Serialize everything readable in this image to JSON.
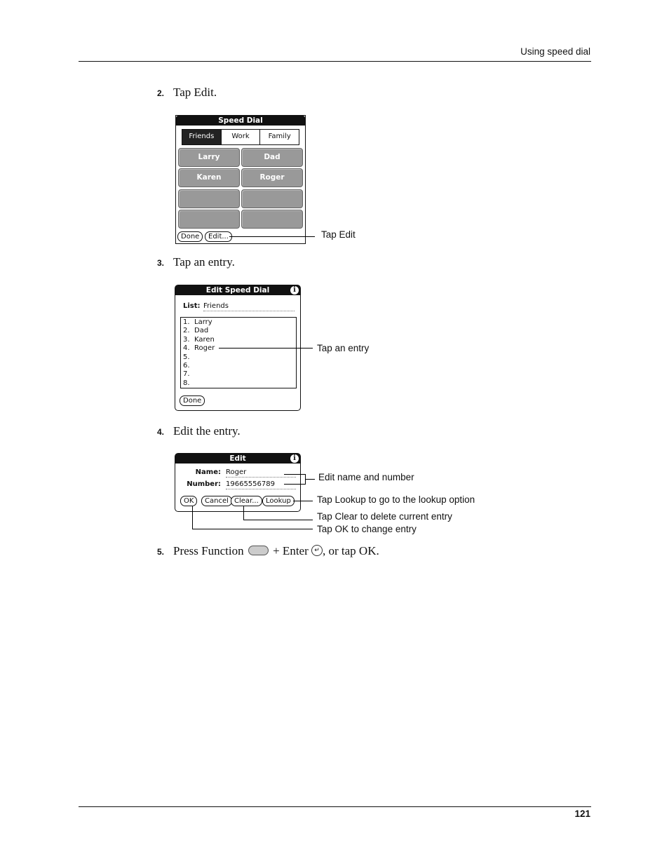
{
  "header": {
    "running_head": "Using speed dial"
  },
  "footer": {
    "page_number": "121"
  },
  "steps": [
    {
      "number": "2.",
      "text": "Tap Edit."
    },
    {
      "number": "3.",
      "text": "Tap an entry."
    },
    {
      "number": "4.",
      "text": "Edit the entry."
    },
    {
      "number": "5.",
      "text_before": "Press Function",
      "text_middle": "+ Enter",
      "text_after": ", or tap OK.",
      "function_icon": "function-key-icon",
      "enter_icon": "enter-key-icon"
    }
  ],
  "screen1": {
    "title": "Speed Dial",
    "tabs": [
      {
        "label": "Friends",
        "selected": true
      },
      {
        "label": "Work",
        "selected": false
      },
      {
        "label": "Family",
        "selected": false
      }
    ],
    "dial_buttons": [
      "Larry",
      "Dad",
      "Karen",
      "Roger",
      "",
      "",
      "",
      ""
    ],
    "buttons": {
      "done": "Done",
      "edit": "Edit..."
    },
    "callout": "Tap Edit"
  },
  "screen2": {
    "title": "Edit Speed Dial",
    "info_icon": "i",
    "list_label": "List:",
    "list_value": "Friends",
    "entries": [
      {
        "num": "1.",
        "name": "Larry"
      },
      {
        "num": "2.",
        "name": "Dad"
      },
      {
        "num": "3.",
        "name": "Karen"
      },
      {
        "num": "4.",
        "name": "Roger"
      },
      {
        "num": "5.",
        "name": ""
      },
      {
        "num": "6.",
        "name": ""
      },
      {
        "num": "7.",
        "name": ""
      },
      {
        "num": "8.",
        "name": ""
      }
    ],
    "buttons": {
      "done": "Done"
    },
    "callout": "Tap an entry"
  },
  "screen3": {
    "title": "Edit",
    "info_icon": "i",
    "name_label": "Name:",
    "name_value": "Roger",
    "number_label": "Number:",
    "number_value": "19665556789",
    "buttons": {
      "ok": "OK",
      "cancel": "Cancel",
      "clear": "Clear...",
      "lookup": "Lookup"
    },
    "callouts": {
      "edit": "Edit name and number",
      "lookup": "Tap Lookup to go to the lookup option",
      "clear": "Tap Clear to delete current entry",
      "ok": "Tap OK to change entry"
    }
  }
}
